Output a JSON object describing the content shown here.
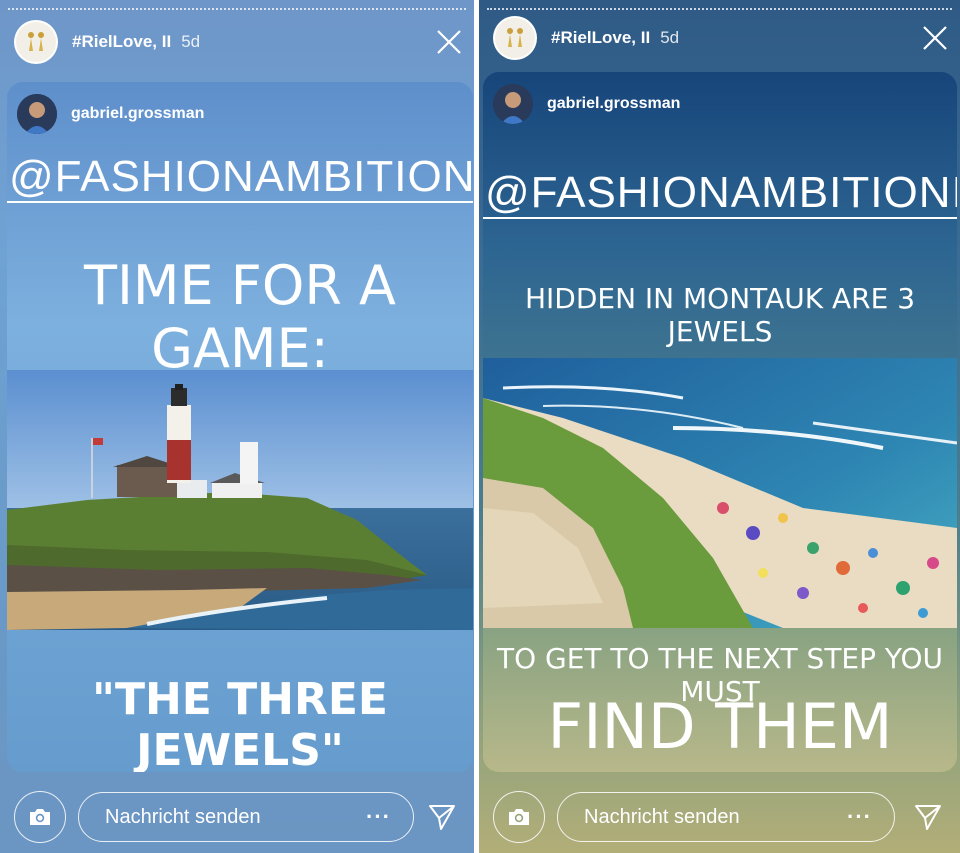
{
  "stories": [
    {
      "header": {
        "name": "#RielLove, II",
        "time": "5d"
      },
      "card": {
        "username": "gabriel.grossman",
        "mention": "@FASHIONAMBITIONIST",
        "headline": "TIME FOR A GAME:",
        "caption": "\"THE THREE JEWELS\""
      },
      "footer": {
        "placeholder": "Nachricht senden",
        "more": "···"
      }
    },
    {
      "header": {
        "name": "#RielLove, II",
        "time": "5d"
      },
      "card": {
        "username": "gabriel.grossman",
        "mention": "@FASHIONAMBITIONIST",
        "headline": "HIDDEN IN MONTAUK ARE 3 JEWELS",
        "caption_small": "TO GET TO THE NEXT STEP YOU MUST",
        "caption_big": "FIND THEM ALL"
      },
      "footer": {
        "placeholder": "Nachricht senden",
        "more": "···"
      }
    }
  ],
  "icons": {
    "close": "close-icon",
    "camera": "camera-icon",
    "send": "send-icon",
    "more": "more-icon"
  }
}
